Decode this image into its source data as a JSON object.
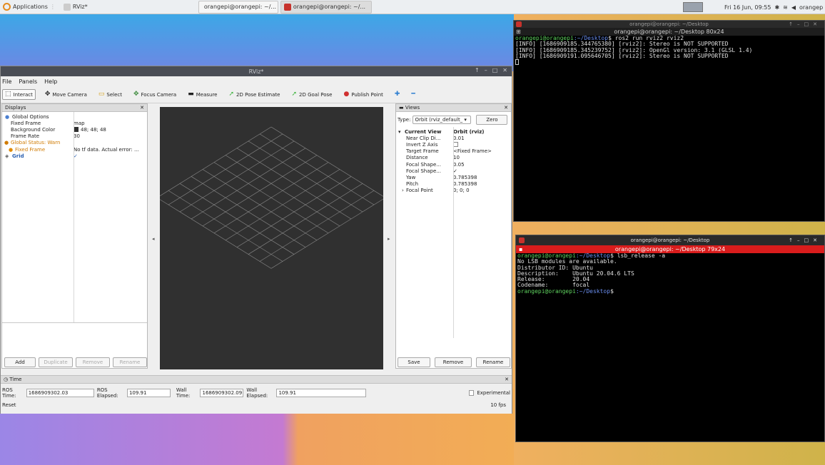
{
  "taskbar": {
    "applications": "Applications",
    "tasks": [
      {
        "label": "RViz*"
      },
      {
        "label": "orangepi@orangepi: ~/..."
      },
      {
        "label": "orangepi@orangepi: ~/..."
      }
    ],
    "clock": "Fri 16 Jun, 09:55",
    "user": "orangep"
  },
  "rviz": {
    "title": "RViz*",
    "menu": [
      "File",
      "Panels",
      "Help"
    ],
    "tools": [
      "Interact",
      "Move Camera",
      "Select",
      "Focus Camera",
      "Measure",
      "2D Pose Estimate",
      "2D Goal Pose",
      "Publish Point"
    ],
    "displays": {
      "title": "Displays",
      "rows": [
        {
          "name": "Global Options",
          "value": ""
        },
        {
          "name": "Fixed Frame",
          "value": "map"
        },
        {
          "name": "Background Color",
          "value": "48; 48; 48"
        },
        {
          "name": "Frame Rate",
          "value": "30"
        },
        {
          "name": "Global Status: Warn",
          "value": ""
        },
        {
          "name": "Fixed Frame",
          "value": "No tf data.  Actual error: ..."
        },
        {
          "name": "Grid",
          "value": "✓"
        }
      ],
      "buttons": [
        "Add",
        "Duplicate",
        "Remove",
        "Rename"
      ]
    },
    "views": {
      "title": "Views",
      "type_label": "Type:",
      "type_value": "Orbit (rviz_default_",
      "zero": "Zero",
      "rows": [
        {
          "name": "Current View",
          "value": "Orbit (rviz)"
        },
        {
          "name": "Near Clip Di...",
          "value": "0.01"
        },
        {
          "name": "Invert Z Axis",
          "value": ""
        },
        {
          "name": "Target Frame",
          "value": "<Fixed Frame>"
        },
        {
          "name": "Distance",
          "value": "10"
        },
        {
          "name": "Focal Shape...",
          "value": "0.05"
        },
        {
          "name": "Focal Shape...",
          "value": "✓"
        },
        {
          "name": "Yaw",
          "value": "0.785398"
        },
        {
          "name": "Pitch",
          "value": "0.785398"
        },
        {
          "name": "Focal Point",
          "value": "0; 0; 0"
        }
      ],
      "buttons": [
        "Save",
        "Remove",
        "Rename"
      ]
    },
    "time": {
      "title": "Time",
      "ros_time_label": "ROS Time:",
      "ros_time": "1686909302.03",
      "ros_elapsed_label": "ROS Elapsed:",
      "ros_elapsed": "109.91",
      "wall_time_label": "Wall Time:",
      "wall_time": "1686909302.09",
      "wall_elapsed_label": "Wall Elapsed:",
      "wall_elapsed": "109.91",
      "experimental": "Experimental",
      "reset": "Reset",
      "fps": "10 fps"
    }
  },
  "terminal1": {
    "title": "orangepi@orangepi: ~/Desktop",
    "tab": "orangepi@orangepi: ~/Desktop 80x24",
    "prompt_user": "orangepi@orangepi",
    "prompt_path": ":~/Desktop",
    "command": "$ ros2 run rviz2 rviz2",
    "lines": [
      "[INFO] [1686909185.344765380] [rviz2]: Stereo is NOT SUPPORTED",
      "[INFO] [1686909185.345239752] [rviz2]: OpenGl version: 3.1 (GLSL 1.4)",
      "[INFO] [1686909191.095646705] [rviz2]: Stereo is NOT SUPPORTED"
    ]
  },
  "terminal2": {
    "title": "orangepi@orangepi: ~/Desktop",
    "tab": "orangepi@orangepi: ~/Desktop 79x24",
    "prompt_user": "orangepi@orangepi",
    "prompt_path": ":~/Desktop",
    "command": "$ lsb_release -a",
    "lines": [
      "No LSB modules are available.",
      "Distributor ID: Ubuntu",
      "Description:    Ubuntu 20.04.6 LTS",
      "Release:        20.04",
      "Codename:       focal"
    ],
    "end_prompt_user": "orangepi@orangepi",
    "end_prompt_path": ":~/Desktop",
    "end_prompt_symbol": "$"
  }
}
